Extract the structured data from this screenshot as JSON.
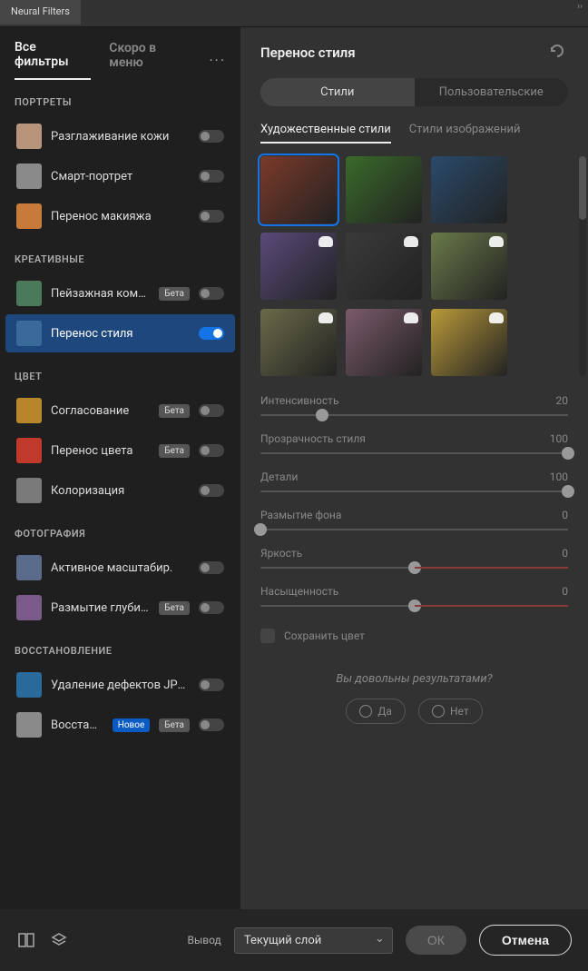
{
  "window": {
    "tab": "Neural Filters"
  },
  "sidebar": {
    "tabs": {
      "all": "Все фильтры",
      "soon": "Скоро в меню"
    },
    "sections": {
      "portraits": {
        "title": "ПОРТРЕТЫ",
        "items": [
          {
            "label": "Разглаживание кожи",
            "color": "#b8957a"
          },
          {
            "label": "Смарт-портрет",
            "color": "#8a8a8a"
          },
          {
            "label": "Перенос макияжа",
            "color": "#c77a3a"
          }
        ]
      },
      "creative": {
        "title": "КРЕАТИВНЫЕ",
        "items": [
          {
            "label": "Пейзажная комп…",
            "color": "#4a7a5a",
            "badge": "Бета"
          },
          {
            "label": "Перенос стиля",
            "color": "#3a6a9a",
            "active": true
          }
        ]
      },
      "color": {
        "title": "ЦВЕТ",
        "items": [
          {
            "label": "Согласование",
            "color": "#b8862a",
            "badge": "Бета"
          },
          {
            "label": "Перенос цвета",
            "color": "#c0392b",
            "badge": "Бета"
          },
          {
            "label": "Колоризация",
            "color": "#7a7a7a"
          }
        ]
      },
      "photo": {
        "title": "ФОТОГРАФИЯ",
        "items": [
          {
            "label": "Активное масштабир.",
            "color": "#5a6a8a"
          },
          {
            "label": "Размытие глубины",
            "color": "#7a5a8a",
            "badge": "Бета"
          }
        ]
      },
      "restore": {
        "title": "ВОССТАНОВЛЕНИЕ",
        "items": [
          {
            "label": "Удаление дефектов JPEG",
            "color": "#2a6a9a"
          },
          {
            "label": "Восстано…",
            "color": "#8a8a8a",
            "badge_new": "Новое",
            "badge": "Бета"
          }
        ]
      }
    }
  },
  "content": {
    "title": "Перенос стиля",
    "seg": {
      "styles": "Стили",
      "custom": "Пользовательские"
    },
    "subtabs": {
      "art": "Художественные стили",
      "image": "Стили изображений"
    },
    "tiles": {
      "colors": [
        "#7a3a2a",
        "#3a6a2a",
        "#2a4a6a",
        "#5a4a7a",
        "#3a3a3a",
        "#6a7a4a",
        "#6a6a4a",
        "#7a5a6a",
        "#b89a3a"
      ]
    },
    "sliders": [
      {
        "name": "Интенсивность",
        "value": "20",
        "pos": 20
      },
      {
        "name": "Прозрачность стиля",
        "value": "100",
        "pos": 100
      },
      {
        "name": "Детали",
        "value": "100",
        "pos": 100
      },
      {
        "name": "Размытие фона",
        "value": "0",
        "pos": 0
      },
      {
        "name": "Яркость",
        "value": "0",
        "pos": 50,
        "bipolar": true
      },
      {
        "name": "Насыщенность",
        "value": "0",
        "pos": 50,
        "bipolar": true
      }
    ],
    "checkbox": "Сохранить цвет",
    "feedback": {
      "q": "Вы довольны результатами?",
      "yes": "Да",
      "no": "Нет"
    }
  },
  "footer": {
    "output_label": "Вывод",
    "output_value": "Текущий слой",
    "ok": "ОК",
    "cancel": "Отмена"
  }
}
